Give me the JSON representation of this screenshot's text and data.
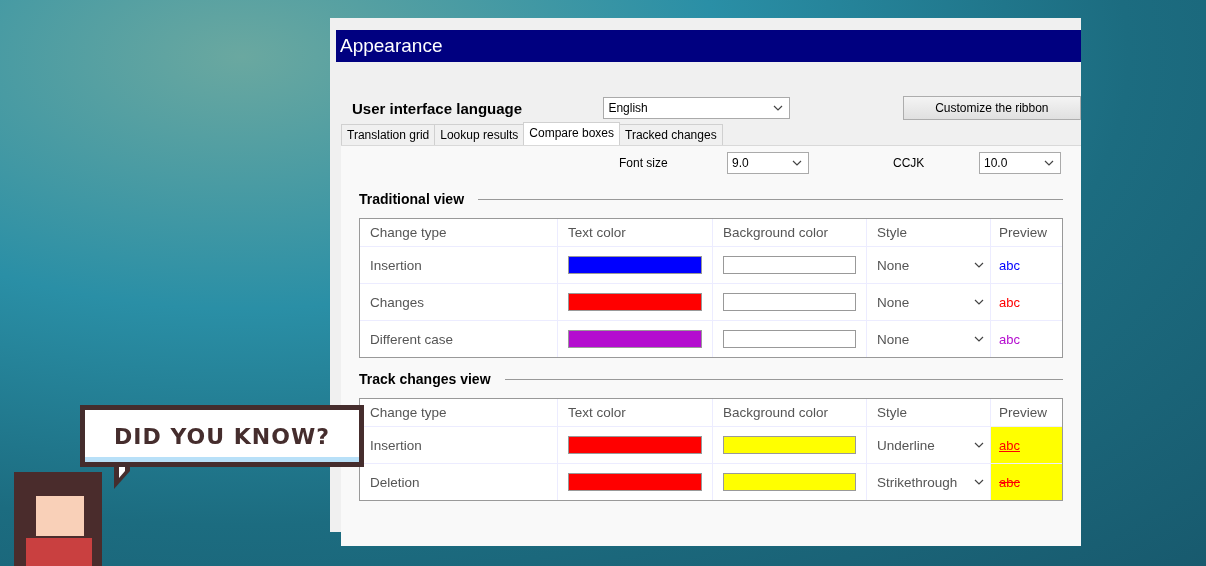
{
  "window": {
    "title": "Appearance"
  },
  "language": {
    "label": "User interface language",
    "value": "English"
  },
  "ribbon_button": "Customize the ribbon",
  "tabs": [
    {
      "label": "Translation grid",
      "selected": false
    },
    {
      "label": "Lookup results",
      "selected": false
    },
    {
      "label": "Compare boxes",
      "selected": true
    },
    {
      "label": "Tracked changes",
      "selected": false
    }
  ],
  "font_size": {
    "label": "Font size",
    "value": "9.0"
  },
  "ccjk": {
    "label": "CCJK",
    "value": "10.0"
  },
  "sections": [
    {
      "title": "Traditional view",
      "columns": [
        "Change type",
        "Text color",
        "Background color",
        "Style",
        "Preview"
      ],
      "rows": [
        {
          "name": "Insertion",
          "text_swatch": {
            "color": "#0000ff"
          },
          "background_swatch": {
            "color": "#ffffff"
          },
          "style": "None",
          "kind": "plain",
          "preview": "abc"
        },
        {
          "name": "Changes",
          "text_swatch": {
            "color": "#ff0000"
          },
          "background_swatch": {
            "color": "#ffffff"
          },
          "style": "None",
          "kind": "plain",
          "preview": "abc"
        },
        {
          "name": "Different case",
          "text_swatch": {
            "color": "#b40ccf"
          },
          "background_swatch": {
            "color": "#ffffff"
          },
          "style": "None",
          "kind": "plain",
          "preview": "abc"
        }
      ]
    },
    {
      "title": "Track changes view",
      "columns": [
        "Change type",
        "Text color",
        "Background color",
        "Style",
        "Preview"
      ],
      "rows": [
        {
          "name": "Insertion",
          "text_swatch": {
            "color": "#ff0000"
          },
          "background_swatch": {
            "color": "#ffff00"
          },
          "style": "Underline",
          "kind": "underline",
          "preview": "abc"
        },
        {
          "name": "Deletion",
          "text_swatch": {
            "color": "#ff0000"
          },
          "background_swatch": {
            "color": "#ffff00"
          },
          "style": "Strikethrough",
          "kind": "strikethrough",
          "preview": "abc"
        }
      ]
    }
  ],
  "callout": {
    "text": "DID YOU KNOW?"
  }
}
